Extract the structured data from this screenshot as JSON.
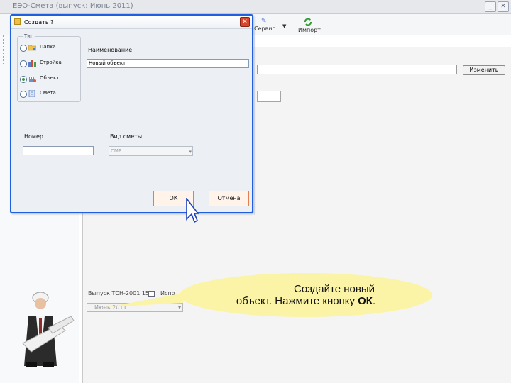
{
  "app": {
    "title": "ЕЭО-Смета (выпуск: Июнь 2011)",
    "toolbar": {
      "service_label": "Сервис",
      "import_label": "Импорт"
    },
    "change_button_label": "Изменить",
    "bottom": {
      "version_label": "Выпуск ТСН-2001.15",
      "check_label": "Испо",
      "release_select_value": "Июнь  2011"
    }
  },
  "dialog": {
    "title": "Создать ?",
    "type_group_label": "Тип",
    "type_options": [
      {
        "label": "Папка",
        "icon": "folder-icon",
        "selected": false
      },
      {
        "label": "Стройка",
        "icon": "construction-icon",
        "selected": false
      },
      {
        "label": "Объект",
        "icon": "object-icon",
        "selected": true
      },
      {
        "label": "Смета",
        "icon": "estimate-icon",
        "selected": false
      }
    ],
    "name_label": "Наименование",
    "name_value": "Новый объект",
    "number_label": "Номер",
    "number_value": "",
    "estimate_kind_label": "Вид сметы",
    "estimate_kind_value": "СМР",
    "ok_label": "ОК",
    "cancel_label": "Отмена"
  },
  "tutorial": {
    "line1": "Создайте  новый",
    "line2_prefix": "объект. Нажмите кнопку ",
    "line2_bold": "ОК",
    "line2_suffix": "."
  },
  "colors": {
    "dialog_border": "#1f5fe0",
    "bubble": "#fbf3a5",
    "button_border": "#e08050"
  }
}
